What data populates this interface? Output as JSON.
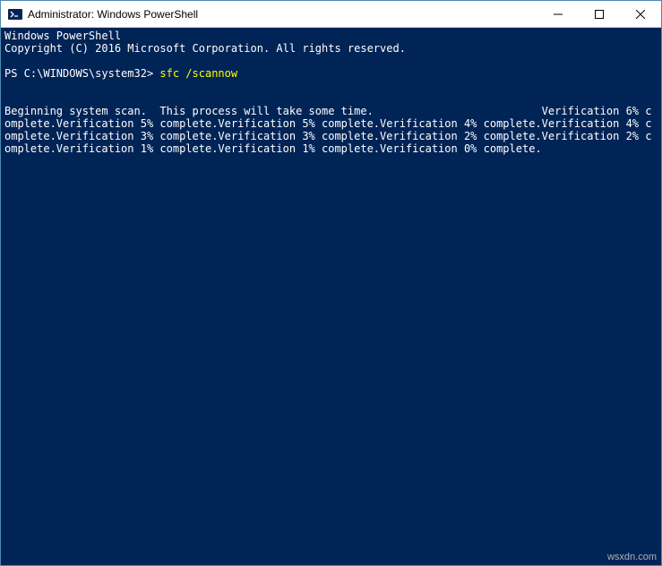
{
  "titlebar": {
    "icon_name": "powershell-icon",
    "title": "Administrator: Windows PowerShell",
    "minimize": "—",
    "maximize": "☐",
    "close": "✕"
  },
  "console": {
    "header1": "Windows PowerShell",
    "header2": "Copyright (C) 2016 Microsoft Corporation. All rights reserved.",
    "prompt": "PS C:\\WINDOWS\\system32> ",
    "command": "sfc /scannow",
    "output": "Beginning system scan.  This process will take some time.                          Verification 6% complete.Verification 5% complete.Verification 5% complete.Verification 4% complete.Verification 4% complete.Verification 3% complete.Verification 3% complete.Verification 2% complete.Verification 2% complete.Verification 1% complete.Verification 1% complete.Verification 0% complete."
  },
  "watermark": "wsxdn.com"
}
